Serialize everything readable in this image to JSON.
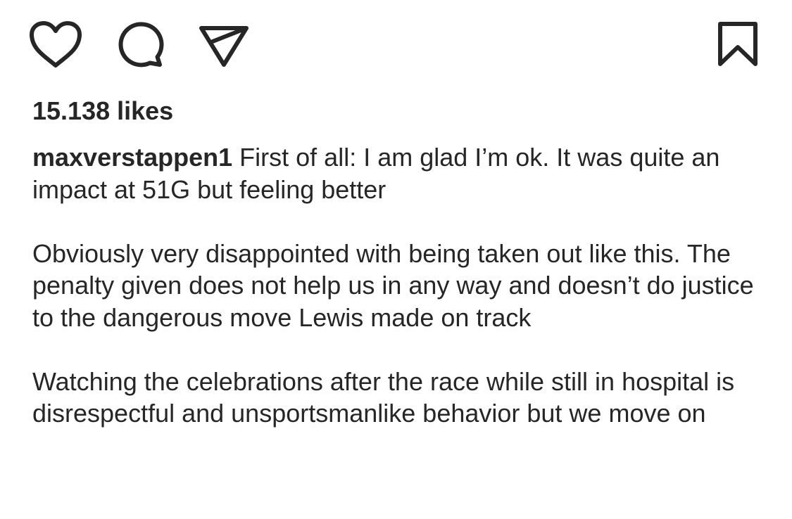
{
  "actions": {
    "like_icon": "heart-outline-icon",
    "comment_icon": "speech-bubble-icon",
    "share_icon": "paper-plane-icon",
    "save_icon": "bookmark-icon",
    "icon_color": "#262626"
  },
  "post": {
    "likes_text": "15.138 likes",
    "username": "maxverstappen1",
    "caption_paragraphs": [
      "First of all: I am glad I’m ok. It was quite an impact at 51G but feeling better",
      "Obviously very disappointed with being taken out like this. The penalty given does not help us in any way and doesn’t do justice to the dangerous move Lewis made on track",
      "Watching the celebrations after the race while still in hospital is disrespectful and unsportsmanlike behavior but we move on"
    ]
  }
}
